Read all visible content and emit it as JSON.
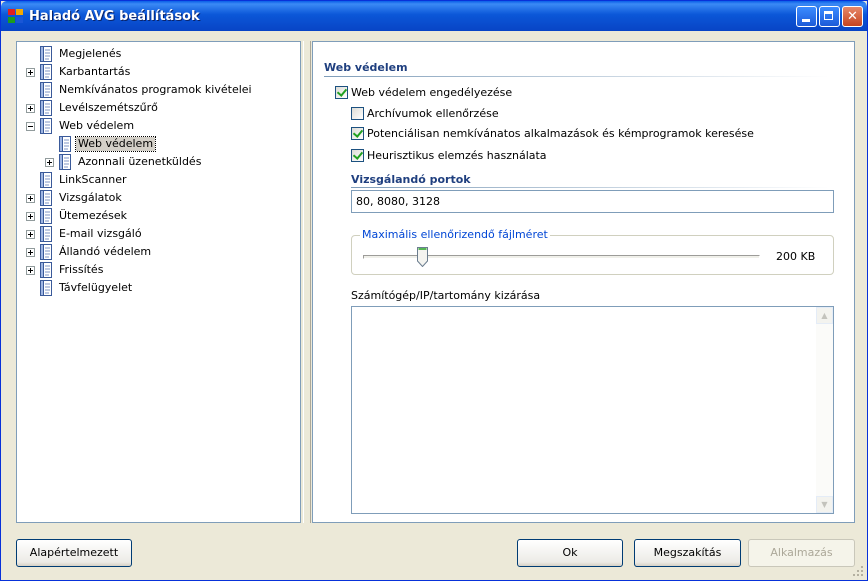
{
  "window": {
    "title": "Haladó AVG beállítások"
  },
  "tree": {
    "items": [
      {
        "label": "Megjelenés",
        "expander": "none",
        "selected": false
      },
      {
        "label": "Karbantartás",
        "expander": "plus",
        "selected": false
      },
      {
        "label": "Nemkívánatos programok kivételei",
        "expander": "none",
        "selected": false
      },
      {
        "label": "Levélszemétszűrő",
        "expander": "plus",
        "selected": false
      },
      {
        "label": "Web védelem",
        "expander": "minus",
        "selected": false
      },
      {
        "label": "Web védelem",
        "expander": "none",
        "selected": true
      },
      {
        "label": "Azonnali üzenetküldés",
        "expander": "plus",
        "selected": false
      },
      {
        "label": "LinkScanner",
        "expander": "none",
        "selected": false
      },
      {
        "label": "Vizsgálatok",
        "expander": "plus",
        "selected": false
      },
      {
        "label": "Ütemezések",
        "expander": "plus",
        "selected": false
      },
      {
        "label": "E-mail vizsgáló",
        "expander": "plus",
        "selected": false
      },
      {
        "label": "Állandó védelem",
        "expander": "plus",
        "selected": false
      },
      {
        "label": "Frissítés",
        "expander": "plus",
        "selected": false
      },
      {
        "label": "Távfelügyelet",
        "expander": "none",
        "selected": false
      }
    ]
  },
  "content": {
    "section_title": "Web védelem",
    "enable_label": "Web védelem engedélyezése",
    "enable_checked": true,
    "options": [
      {
        "label": "Archívumok ellenőrzése",
        "checked": false
      },
      {
        "label": "Potenciálisan nemkívánatos alkalmazások és kémprogramok keresése",
        "checked": true
      },
      {
        "label": "Heurisztikus elemzés használata",
        "checked": true
      }
    ],
    "ports_title": "Vizsgálandó portok",
    "ports_value": "80, 8080, 3128",
    "max_size_label": "Maximális ellenőrizendő fájlméret",
    "max_size_value": "200 KB",
    "max_size_slider_fraction": 0.15,
    "exclude_label": "Számítógép/IP/tartomány kizárása",
    "exclude_value": ""
  },
  "buttons": {
    "defaults": "Alapértelmezett",
    "ok": "Ok",
    "cancel": "Megszakítás",
    "apply": "Alkalmazás"
  },
  "colors": {
    "title_bar": "#0a5fe8",
    "section_title": "#1f3f7f",
    "group_legend": "#0046d5",
    "check_mark": "#21a121"
  },
  "icons": {
    "app": "avg-logo-icon",
    "tree_items": "settings-document-icon"
  }
}
